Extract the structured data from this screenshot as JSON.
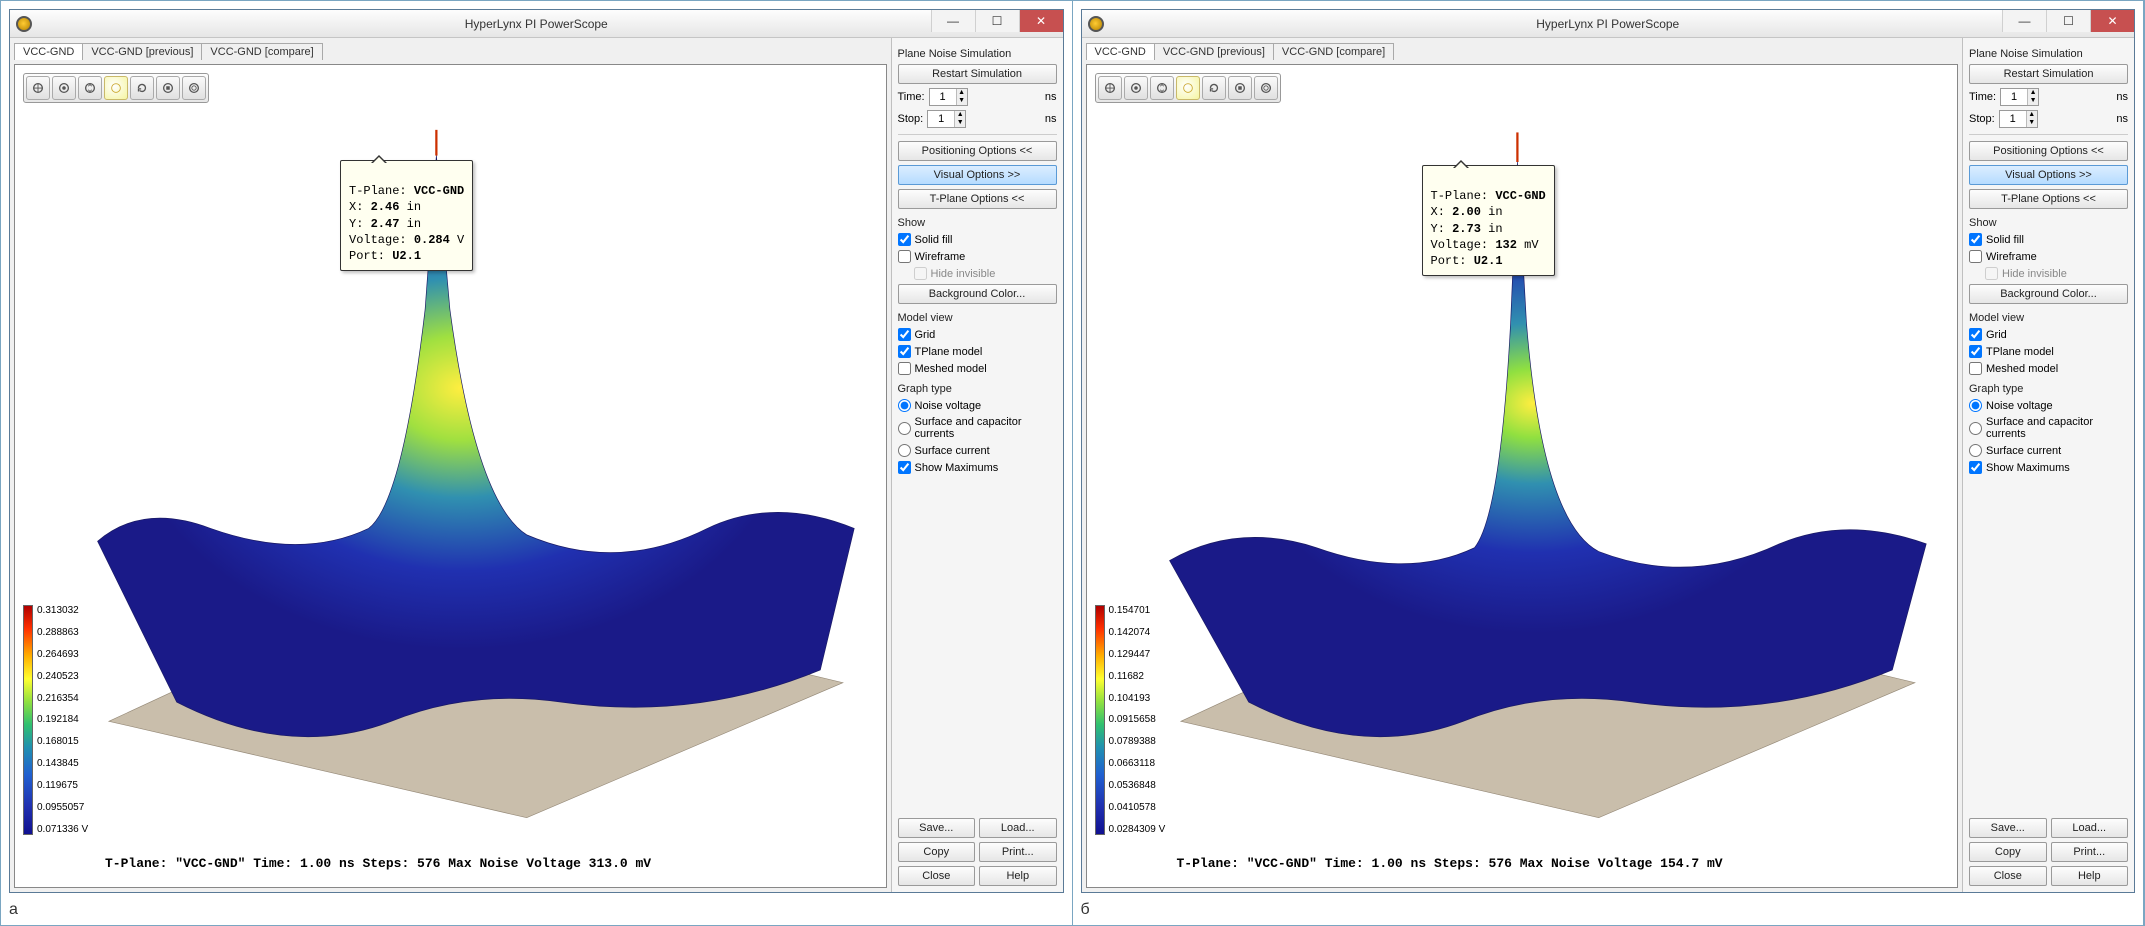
{
  "windows": [
    {
      "title": "HyperLynx PI PowerScope",
      "caption": "а",
      "tabs": [
        {
          "label": "VCC-GND",
          "active": true
        },
        {
          "label": "VCC-GND [previous]",
          "active": false
        },
        {
          "label": "VCC-GND [compare]",
          "active": false
        }
      ],
      "tooltip": {
        "t_plane_label": "T-Plane:",
        "t_plane_value": "VCC-GND",
        "x_label": "X:",
        "x_value": "2.46",
        "x_unit": "in",
        "y_label": "Y:",
        "y_value": "2.47",
        "y_unit": "in",
        "voltage_label": "Voltage:",
        "voltage_value": "0.284",
        "voltage_unit": "V",
        "port_label": "Port:",
        "port_value": "U2.1"
      },
      "legend": {
        "ticks": [
          "0.313032",
          "0.288863",
          "0.264693",
          "0.240523",
          "0.216354",
          "0.192184",
          "0.168015",
          "0.143845",
          "0.119675",
          "0.0955057",
          "0.071336"
        ],
        "unit": "V"
      },
      "status": "T-Plane: \"VCC-GND\" Time: 1.00 ns Steps: 576  Max Noise Voltage 313.0 mV",
      "side": {
        "group_sim": "Plane Noise Simulation",
        "restart": "Restart Simulation",
        "time_label": "Time:",
        "time_value": "1",
        "time_unit": "ns",
        "stop_label": "Stop:",
        "stop_value": "1",
        "stop_unit": "ns",
        "positioning": "Positioning Options <<",
        "visual": "Visual Options >>",
        "tplane_opts": "T-Plane Options <<",
        "show_label": "Show",
        "solid_fill": "Solid fill",
        "wireframe": "Wireframe",
        "hide_invisible": "Hide invisible",
        "bg_color": "Background Color...",
        "model_view": "Model view",
        "grid": "Grid",
        "tplane_model": "TPlane model",
        "meshed_model": "Meshed model",
        "graph_type": "Graph type",
        "noise_voltage": "Noise voltage",
        "surf_cap": "Surface and capacitor currents",
        "surf_cur": "Surface current",
        "show_max": "Show Maximums",
        "save": "Save...",
        "load": "Load...",
        "copy": "Copy",
        "print": "Print...",
        "close": "Close",
        "help": "Help"
      }
    },
    {
      "title": "HyperLynx PI PowerScope",
      "caption": "б",
      "tabs": [
        {
          "label": "VCC-GND",
          "active": true
        },
        {
          "label": "VCC-GND [previous]",
          "active": false
        },
        {
          "label": "VCC-GND [compare]",
          "active": false
        }
      ],
      "tooltip": {
        "t_plane_label": "T-Plane:",
        "t_plane_value": "VCC-GND",
        "x_label": "X:",
        "x_value": "2.00",
        "x_unit": "in",
        "y_label": "Y:",
        "y_value": "2.73",
        "y_unit": "in",
        "voltage_label": "Voltage:",
        "voltage_value": "132",
        "voltage_unit": "mV",
        "port_label": "Port:",
        "port_value": "U2.1"
      },
      "legend": {
        "ticks": [
          "0.154701",
          "0.142074",
          "0.129447",
          "0.11682",
          "0.104193",
          "0.0915658",
          "0.0789388",
          "0.0663118",
          "0.0536848",
          "0.0410578",
          "0.0284309"
        ],
        "unit": "V"
      },
      "status": "T-Plane: \"VCC-GND\" Time: 1.00 ns Steps: 576  Max Noise Voltage 154.7 mV",
      "side": {
        "group_sim": "Plane Noise Simulation",
        "restart": "Restart Simulation",
        "time_label": "Time:",
        "time_value": "1",
        "time_unit": "ns",
        "stop_label": "Stop:",
        "stop_value": "1",
        "stop_unit": "ns",
        "positioning": "Positioning Options <<",
        "visual": "Visual Options >>",
        "tplane_opts": "T-Plane Options <<",
        "show_label": "Show",
        "solid_fill": "Solid fill",
        "wireframe": "Wireframe",
        "hide_invisible": "Hide invisible",
        "bg_color": "Background Color...",
        "model_view": "Model view",
        "grid": "Grid",
        "tplane_model": "TPlane model",
        "meshed_model": "Meshed model",
        "graph_type": "Graph type",
        "noise_voltage": "Noise voltage",
        "surf_cap": "Surface and capacitor currents",
        "surf_cur": "Surface current",
        "show_max": "Show Maximums",
        "save": "Save...",
        "load": "Load...",
        "copy": "Copy",
        "print": "Print...",
        "close": "Close",
        "help": "Help"
      }
    }
  ],
  "toolbar_icons": [
    "orbit-icon",
    "zoom-extents-icon",
    "pan-icon",
    "spotlight-icon",
    "reset-icon",
    "stop-icon",
    "view-all-icon"
  ],
  "chart_data": [
    {
      "type": "heatmap",
      "title": "VCC-GND T-Plane Noise Voltage",
      "value_label": "Noise voltage",
      "value_unit": "V",
      "zlim": [
        0.071336,
        0.313032
      ],
      "x_unit": "in",
      "y_unit": "in",
      "peak": {
        "x": 2.46,
        "y": 2.47,
        "voltage_V": 0.284,
        "port": "U2.1"
      },
      "time_ns": 1.0,
      "steps": 576,
      "max_noise_voltage_mV": 313.0,
      "legend_ticks_V": [
        0.313032,
        0.288863,
        0.264693,
        0.240523,
        0.216354,
        0.192184,
        0.168015,
        0.143845,
        0.119675,
        0.0955057,
        0.071336
      ]
    },
    {
      "type": "heatmap",
      "title": "VCC-GND T-Plane Noise Voltage",
      "value_label": "Noise voltage",
      "value_unit": "V",
      "zlim": [
        0.0284309,
        0.154701
      ],
      "x_unit": "in",
      "y_unit": "in",
      "peak": {
        "x": 2.0,
        "y": 2.73,
        "voltage_mV": 132,
        "port": "U2.1"
      },
      "time_ns": 1.0,
      "steps": 576,
      "max_noise_voltage_mV": 154.7,
      "legend_ticks_V": [
        0.154701,
        0.142074,
        0.129447,
        0.11682,
        0.104193,
        0.0915658,
        0.0789388,
        0.0663118,
        0.0536848,
        0.0410578,
        0.0284309
      ]
    }
  ]
}
